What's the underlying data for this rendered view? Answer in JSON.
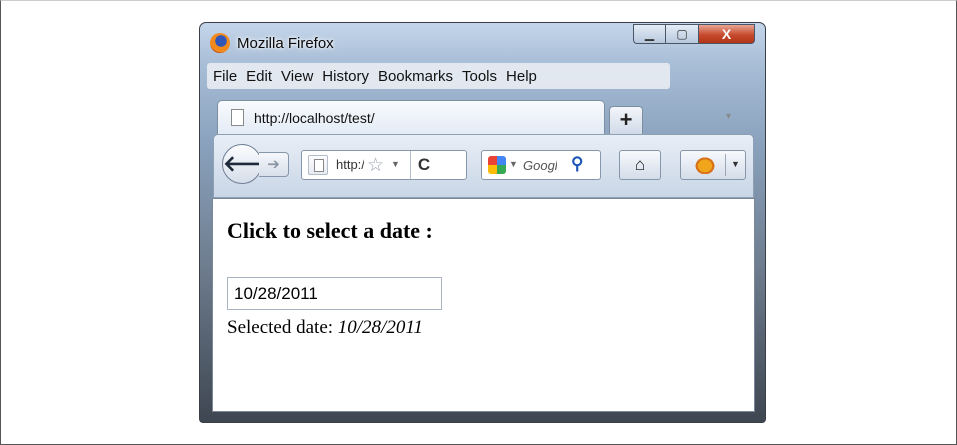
{
  "window": {
    "title": "Mozilla Firefox",
    "controls": {
      "minimize": "▁",
      "maximize": "▢",
      "close": "X"
    }
  },
  "menu": [
    "File",
    "Edit",
    "View",
    "History",
    "Bookmarks",
    "Tools",
    "Help"
  ],
  "tab": {
    "title": "http://localhost/test/",
    "new_tab": "+"
  },
  "nav": {
    "url_visible": "http://localhost/test/",
    "search_engine_text": "Google"
  },
  "page": {
    "heading": "Click to select a date :",
    "date_value": "10/28/2011",
    "selected_label": "Selected date:",
    "selected_value": "10/28/2011"
  },
  "colors": {
    "chrome": "#a9bed7",
    "close_button": "#c64a2e"
  }
}
